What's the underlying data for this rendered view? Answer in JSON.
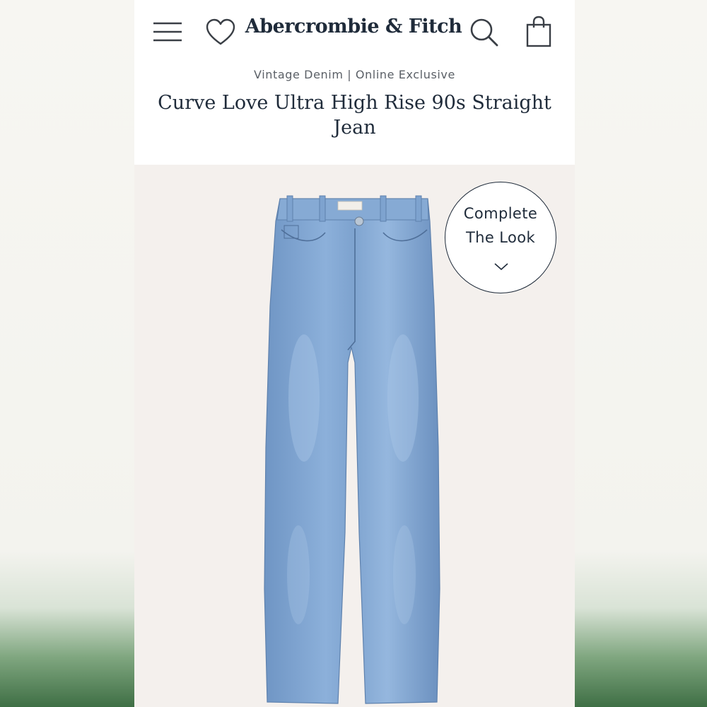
{
  "header": {
    "logo": "Abercrombie & Fitch",
    "icons": [
      "menu-icon",
      "heart-icon",
      "search-icon",
      "bag-icon"
    ]
  },
  "product": {
    "meta": "Vintage Denim | Online Exclusive",
    "title": "Curve Love Ultra High Rise 90s Straight Jean"
  },
  "complete_look": {
    "line1": "Complete",
    "line2": "The Look",
    "icon": "chevron-down-icon"
  },
  "colors": {
    "text_primary": "#1f2b3a",
    "text_secondary": "#5a5f66",
    "image_bg": "#f4f0ed",
    "denim": "#7ea3cf",
    "bottom_green": "#3f6f45"
  }
}
